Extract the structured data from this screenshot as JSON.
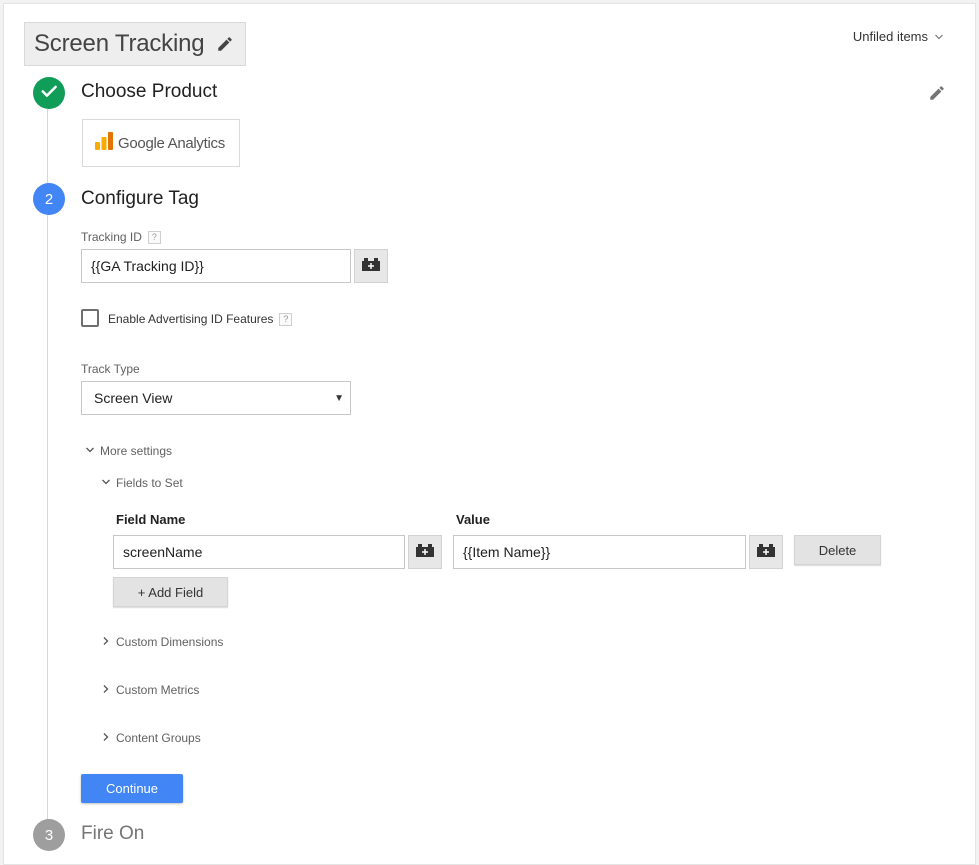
{
  "header": {
    "tag_name": "Screen Tracking",
    "folder_label": "Unfiled items"
  },
  "steps": {
    "step1": {
      "title": "Choose Product",
      "product_name": "Google Analytics"
    },
    "step2": {
      "number": "2",
      "title": "Configure Tag"
    },
    "step3": {
      "number": "3",
      "title": "Fire On"
    }
  },
  "config": {
    "tracking_id_label": "Tracking ID",
    "tracking_id_value": "{{GA Tracking ID}}",
    "help_glyph": "?",
    "advertising_label": "Enable Advertising ID Features",
    "advertising_checked": false,
    "track_type_label": "Track Type",
    "track_type_value": "Screen View",
    "more_settings_label": "More settings",
    "fields_to_set_label": "Fields to Set",
    "field_name_header": "Field Name",
    "value_header": "Value",
    "field_row": {
      "name": "screenName",
      "value": "{{Item Name}}"
    },
    "delete_label": "Delete",
    "add_field_label": "+ Add Field",
    "custom_dimensions_label": "Custom Dimensions",
    "custom_metrics_label": "Custom Metrics",
    "content_groups_label": "Content Groups",
    "continue_label": "Continue"
  },
  "colors": {
    "complete": "#0f9d58",
    "active": "#4285f4",
    "inactive": "#9e9e9e",
    "ga_orange": "#f9ab00",
    "ga_dark_orange": "#e37400"
  },
  "icons": [
    "pencil-icon",
    "chevron-down-icon",
    "check-icon",
    "variable-brick-icon",
    "chevron-right-icon"
  ]
}
